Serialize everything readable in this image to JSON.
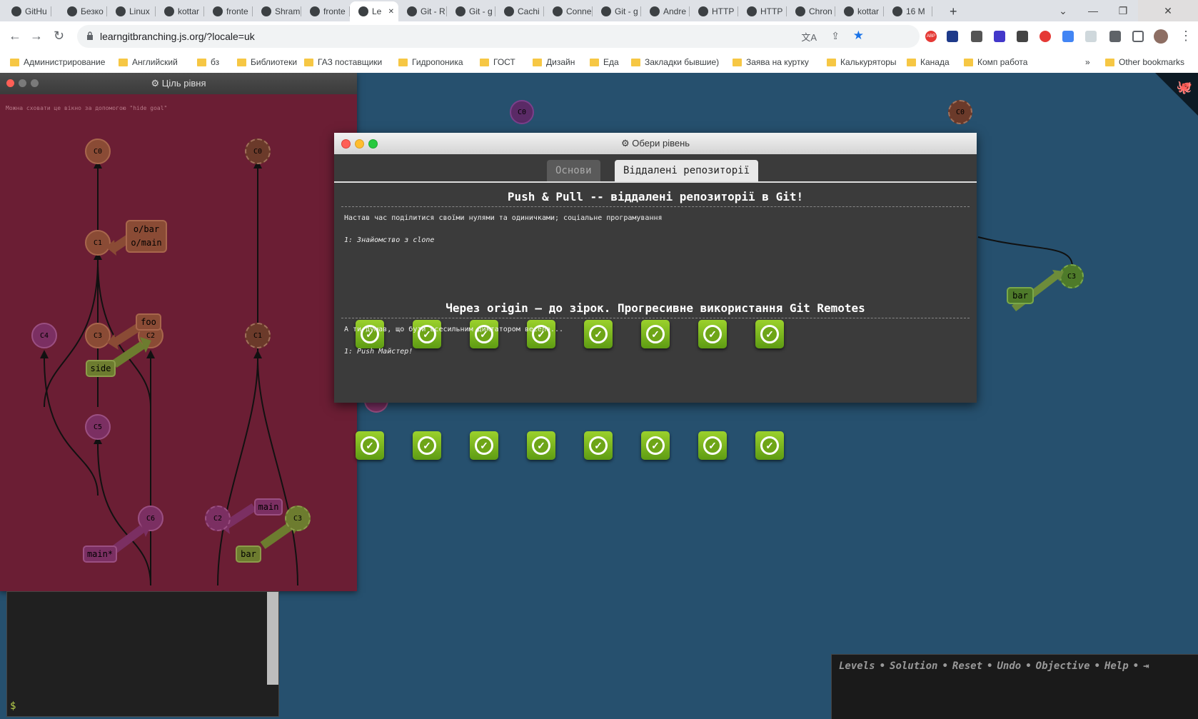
{
  "browser": {
    "tabs": [
      {
        "label": "GitHu",
        "active": false
      },
      {
        "label": "Безко",
        "active": false
      },
      {
        "label": "Linux",
        "active": false
      },
      {
        "label": "kottar",
        "active": false
      },
      {
        "label": "fronte",
        "active": false
      },
      {
        "label": "Shram",
        "active": false
      },
      {
        "label": "fronte",
        "active": false
      },
      {
        "label": "Le",
        "active": true
      },
      {
        "label": "Git - R",
        "active": false
      },
      {
        "label": "Git - g",
        "active": false
      },
      {
        "label": "Cachi",
        "active": false
      },
      {
        "label": "Conne",
        "active": false
      },
      {
        "label": "Git - g",
        "active": false
      },
      {
        "label": "Andre",
        "active": false
      },
      {
        "label": "HTTP",
        "active": false
      },
      {
        "label": "HTTP",
        "active": false
      },
      {
        "label": "Chron",
        "active": false
      },
      {
        "label": "kottar",
        "active": false
      },
      {
        "label": "16 M",
        "active": false
      }
    ],
    "url": "learngitbranching.js.org/?locale=uk",
    "bookmarks": [
      "Администрирование",
      "Английский",
      "бз",
      "Библиотеки",
      "ГАЗ поставщики",
      "Гидропоника",
      "ГОСТ",
      "Дизайн",
      "Еда",
      "Закладки бывшие)",
      "Заява на куртку",
      "Калькуряторы",
      "Канада",
      "Комп работа"
    ],
    "other_bookmarks": "Other bookmarks",
    "overflow": "»",
    "new_tab": "+",
    "ext_abp": "ABP"
  },
  "goal_window": {
    "title": "⚙ Ціль рівня",
    "hint": "Можна сховати це вікно за допомогою \"hide goal\"",
    "left_tree": {
      "commits": [
        "C0",
        "C1",
        "C4",
        "C3",
        "C2",
        "C5",
        "C6"
      ],
      "branches": [
        "o/bar\no/main",
        "foo",
        "side",
        "main*"
      ]
    },
    "right_tree": {
      "commits": [
        "C0",
        "C1",
        "C2",
        "C3"
      ],
      "branches": [
        "main",
        "bar"
      ]
    }
  },
  "background_tree": {
    "commits": [
      "C0",
      "C0",
      "C6",
      "C3"
    ],
    "branches": [
      "bar"
    ]
  },
  "level_dialog": {
    "title": "⚙ Обери рівень",
    "tabs": [
      "Основи",
      "Віддалені репозиторії"
    ],
    "active_tab": 1,
    "sections": [
      {
        "title": "Push & Pull -- віддалені репозиторії в Git!",
        "about": "Настав час поділитися своїми нулями та одиничками; соціальне програмування",
        "selected": "1: Знайомство з clone",
        "levels": 8
      },
      {
        "title": "Через origin – до зірок. Прогресивне використання Git Remotes",
        "about": "А ти думав, що бути всесильним диктатором весело...",
        "selected": "1: Push Майстер!",
        "levels": 8
      }
    ]
  },
  "terminal": {
    "prompt": "$"
  },
  "command_bar": {
    "links": [
      "Levels",
      "Solution",
      "Reset",
      "Undo",
      "Objective",
      "Help"
    ],
    "separator": "•",
    "exit_icon": "⇥"
  },
  "colors": {
    "background": "#26506e",
    "goal_background": "#6b1e34",
    "level_done": "#7ab51d",
    "branch_orange": "#8a4b35",
    "branch_green": "#6d7c2f",
    "branch_purple": "#7b2f62"
  }
}
